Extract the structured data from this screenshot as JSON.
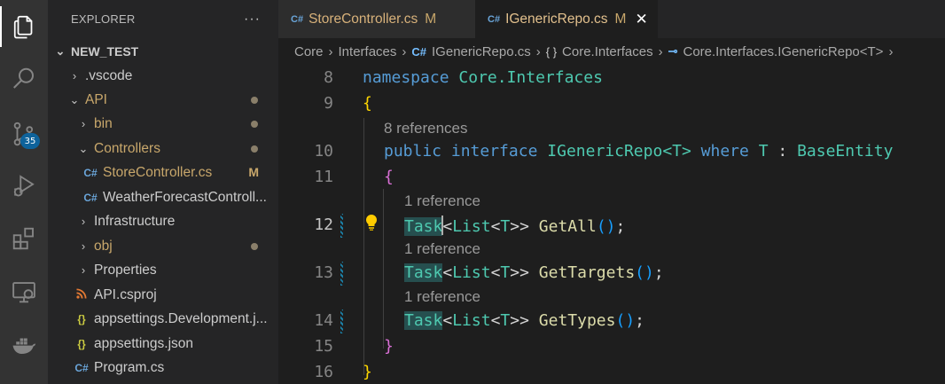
{
  "activity_bar": {
    "items": [
      {
        "icon": "files-icon"
      },
      {
        "icon": "search-icon"
      },
      {
        "icon": "source-control-icon",
        "badge": "35"
      },
      {
        "icon": "run-debug-icon"
      },
      {
        "icon": "extensions-icon"
      },
      {
        "icon": "remote-explorer-icon"
      },
      {
        "icon": "docker-icon"
      }
    ]
  },
  "sidebar": {
    "title": "EXPLORER",
    "more": "···",
    "tree": [
      {
        "label": "NEW_TEST",
        "chevron": "⌄",
        "depth": 0
      },
      {
        "label": ".vscode",
        "chevron": "›",
        "depth": 1
      },
      {
        "label": "API",
        "chevron": "⌄",
        "depth": 1
      },
      {
        "label": "bin",
        "chevron": "›",
        "depth": 2
      },
      {
        "label": "Controllers",
        "chevron": "⌄",
        "depth": 2
      },
      {
        "label": "StoreController.cs",
        "icon": "C#",
        "status": "M",
        "depth": 3
      },
      {
        "label": "WeatherForecastControll...",
        "icon": "C#",
        "depth": 3
      },
      {
        "label": "Infrastructure",
        "chevron": "›",
        "depth": 2
      },
      {
        "label": "obj",
        "chevron": "›",
        "depth": 2
      },
      {
        "label": "Properties",
        "chevron": "›",
        "depth": 2
      },
      {
        "label": "API.csproj",
        "icon": "rss",
        "depth": 2
      },
      {
        "label": "appsettings.Development.j...",
        "icon": "{}",
        "depth": 2
      },
      {
        "label": "appsettings.json",
        "icon": "{}",
        "depth": 2
      },
      {
        "label": "Program.cs",
        "icon": "C#",
        "depth": 2
      }
    ]
  },
  "tabs": [
    {
      "label": "StoreController.cs",
      "status": "M",
      "icon": "C#"
    },
    {
      "label": "IGenericRepo.cs",
      "status": "M",
      "icon": "C#",
      "close": "✕"
    }
  ],
  "breadcrumbs": {
    "parts": [
      "Core",
      "Interfaces",
      "IGenericRepo.cs",
      "Core.Interfaces",
      "Core.Interfaces.IGenericRepo<T>"
    ],
    "sep": "›",
    "icons": {
      "file": "C#",
      "namespace": "{ }",
      "interface": "⊸"
    }
  },
  "editor": {
    "line_numbers": [
      "8",
      "9",
      "10",
      "11",
      "12",
      "13",
      "14",
      "15",
      "16"
    ],
    "codelens": {
      "interface_refs": "8 references",
      "method_ref": "1 reference"
    },
    "tokens": {
      "namespace_kw": "namespace",
      "namespace_name": "Core.Interfaces",
      "open_brace": "{",
      "close_brace": "}",
      "public_kw": "public",
      "interface_kw": "interface",
      "interface_name": "IGenericRepo",
      "type_param": "<T>",
      "where_kw": "where",
      "T": "T",
      "colon": ":",
      "base_type": "BaseEntity",
      "task": "Task",
      "list_generic_open": "<",
      "list": "List",
      "lt": "<",
      "gt_gt": ">>",
      "method1": "GetAll",
      "method2": "GetTargets",
      "method3": "GetTypes",
      "paren": "()",
      "semicolon": ";",
      "bulb": "💡"
    }
  },
  "colors": {
    "keyword": "#569cd6",
    "type": "#4ec9b0",
    "method": "#dcdcaa",
    "modified": "#c8a76b"
  }
}
